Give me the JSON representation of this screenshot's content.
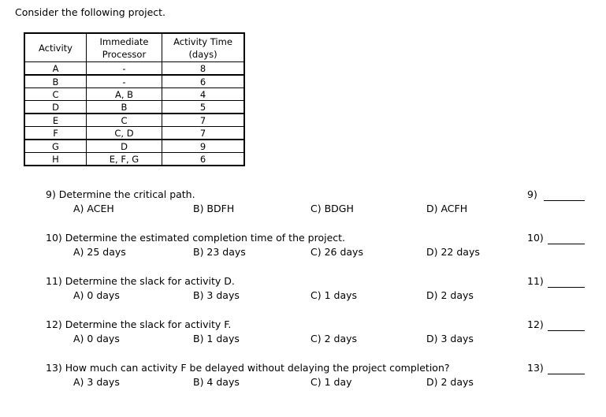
{
  "intro": "Consider the following project.",
  "table": {
    "headers": [
      "Activity",
      "Immediate\nProcessor",
      "Activity Time\n(days)"
    ],
    "header_lines": [
      [
        "Activity"
      ],
      [
        "Immediate",
        "Processor"
      ],
      [
        "Activity Time",
        "(days)"
      ]
    ],
    "rows": [
      {
        "activity": "A",
        "predecessor": "-",
        "time": "8"
      },
      {
        "activity": "B",
        "predecessor": "-",
        "time": "6"
      },
      {
        "activity": "C",
        "predecessor": "A, B",
        "time": "4"
      },
      {
        "activity": "D",
        "predecessor": "B",
        "time": "5"
      },
      {
        "activity": "E",
        "predecessor": "C",
        "time": "7"
      },
      {
        "activity": "F",
        "predecessor": "C, D",
        "time": "7"
      },
      {
        "activity": "G",
        "predecessor": "D",
        "time": "9"
      },
      {
        "activity": "H",
        "predecessor": "E, F, G",
        "time": "6"
      }
    ]
  },
  "questions": [
    {
      "number": "9)",
      "stem": "9) Determine the critical path.",
      "options": [
        "A) ACEH",
        "B) BDFH",
        "C) BDGH",
        "D) ACFH"
      ]
    },
    {
      "number": "10)",
      "stem": "10) Determine the estimated completion time of the project.",
      "options": [
        "A) 25 days",
        "B) 23 days",
        "C) 26 days",
        "D) 22 days"
      ]
    },
    {
      "number": "11)",
      "stem": "11) Determine the slack for activity D.",
      "options": [
        "A) 0 days",
        "B) 3 days",
        "C) 1 days",
        "D) 2 days"
      ]
    },
    {
      "number": "12)",
      "stem": "12) Determine the slack for activity F.",
      "options": [
        "A) 0 days",
        "B) 1 days",
        "C) 2 days",
        "D) 3 days"
      ]
    },
    {
      "number": "13)",
      "stem": "13) How much can activity F be delayed without delaying the project completion?",
      "options": [
        "A) 3 days",
        "B) 4 days",
        "C) 1 day",
        "D) 2 days"
      ]
    }
  ]
}
